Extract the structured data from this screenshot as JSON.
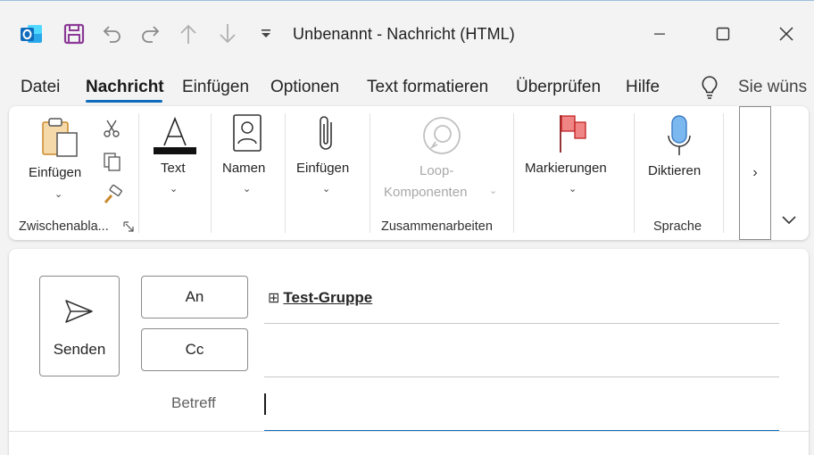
{
  "window": {
    "title": "Unbenannt  -  Nachricht (HTML)"
  },
  "menu": {
    "items": [
      "Datei",
      "Nachricht",
      "Einfügen",
      "Optionen",
      "Text formatieren",
      "Überprüfen",
      "Hilfe"
    ],
    "active": "Nachricht",
    "tell_me": "Sie wüns"
  },
  "ribbon": {
    "clipboard": {
      "paste_label": "Einfügen",
      "group_label": "Zwischenabla..."
    },
    "text": {
      "label": "Text"
    },
    "names": {
      "label": "Namen"
    },
    "include": {
      "label": "Einfügen"
    },
    "loop": {
      "line1": "Loop-",
      "line2": "Komponenten",
      "group_label": "Zusammenarbeiten"
    },
    "tags": {
      "label": "Markierungen"
    },
    "voice": {
      "label": "Diktieren",
      "group_label": "Sprache"
    },
    "more_label": "›"
  },
  "compose": {
    "send_label": "Senden",
    "to_label": "An",
    "cc_label": "Cc",
    "subject_label": "Betreff",
    "recipient": "Test-Gruppe",
    "recipient_expand": "⊞"
  },
  "colors": {
    "accent": "#0f6cbd",
    "outlook_blue": "#0f6cbd",
    "save_purple": "#8b3a96",
    "flag_red": "#e04848",
    "mic_blue": "#6aaee8"
  }
}
